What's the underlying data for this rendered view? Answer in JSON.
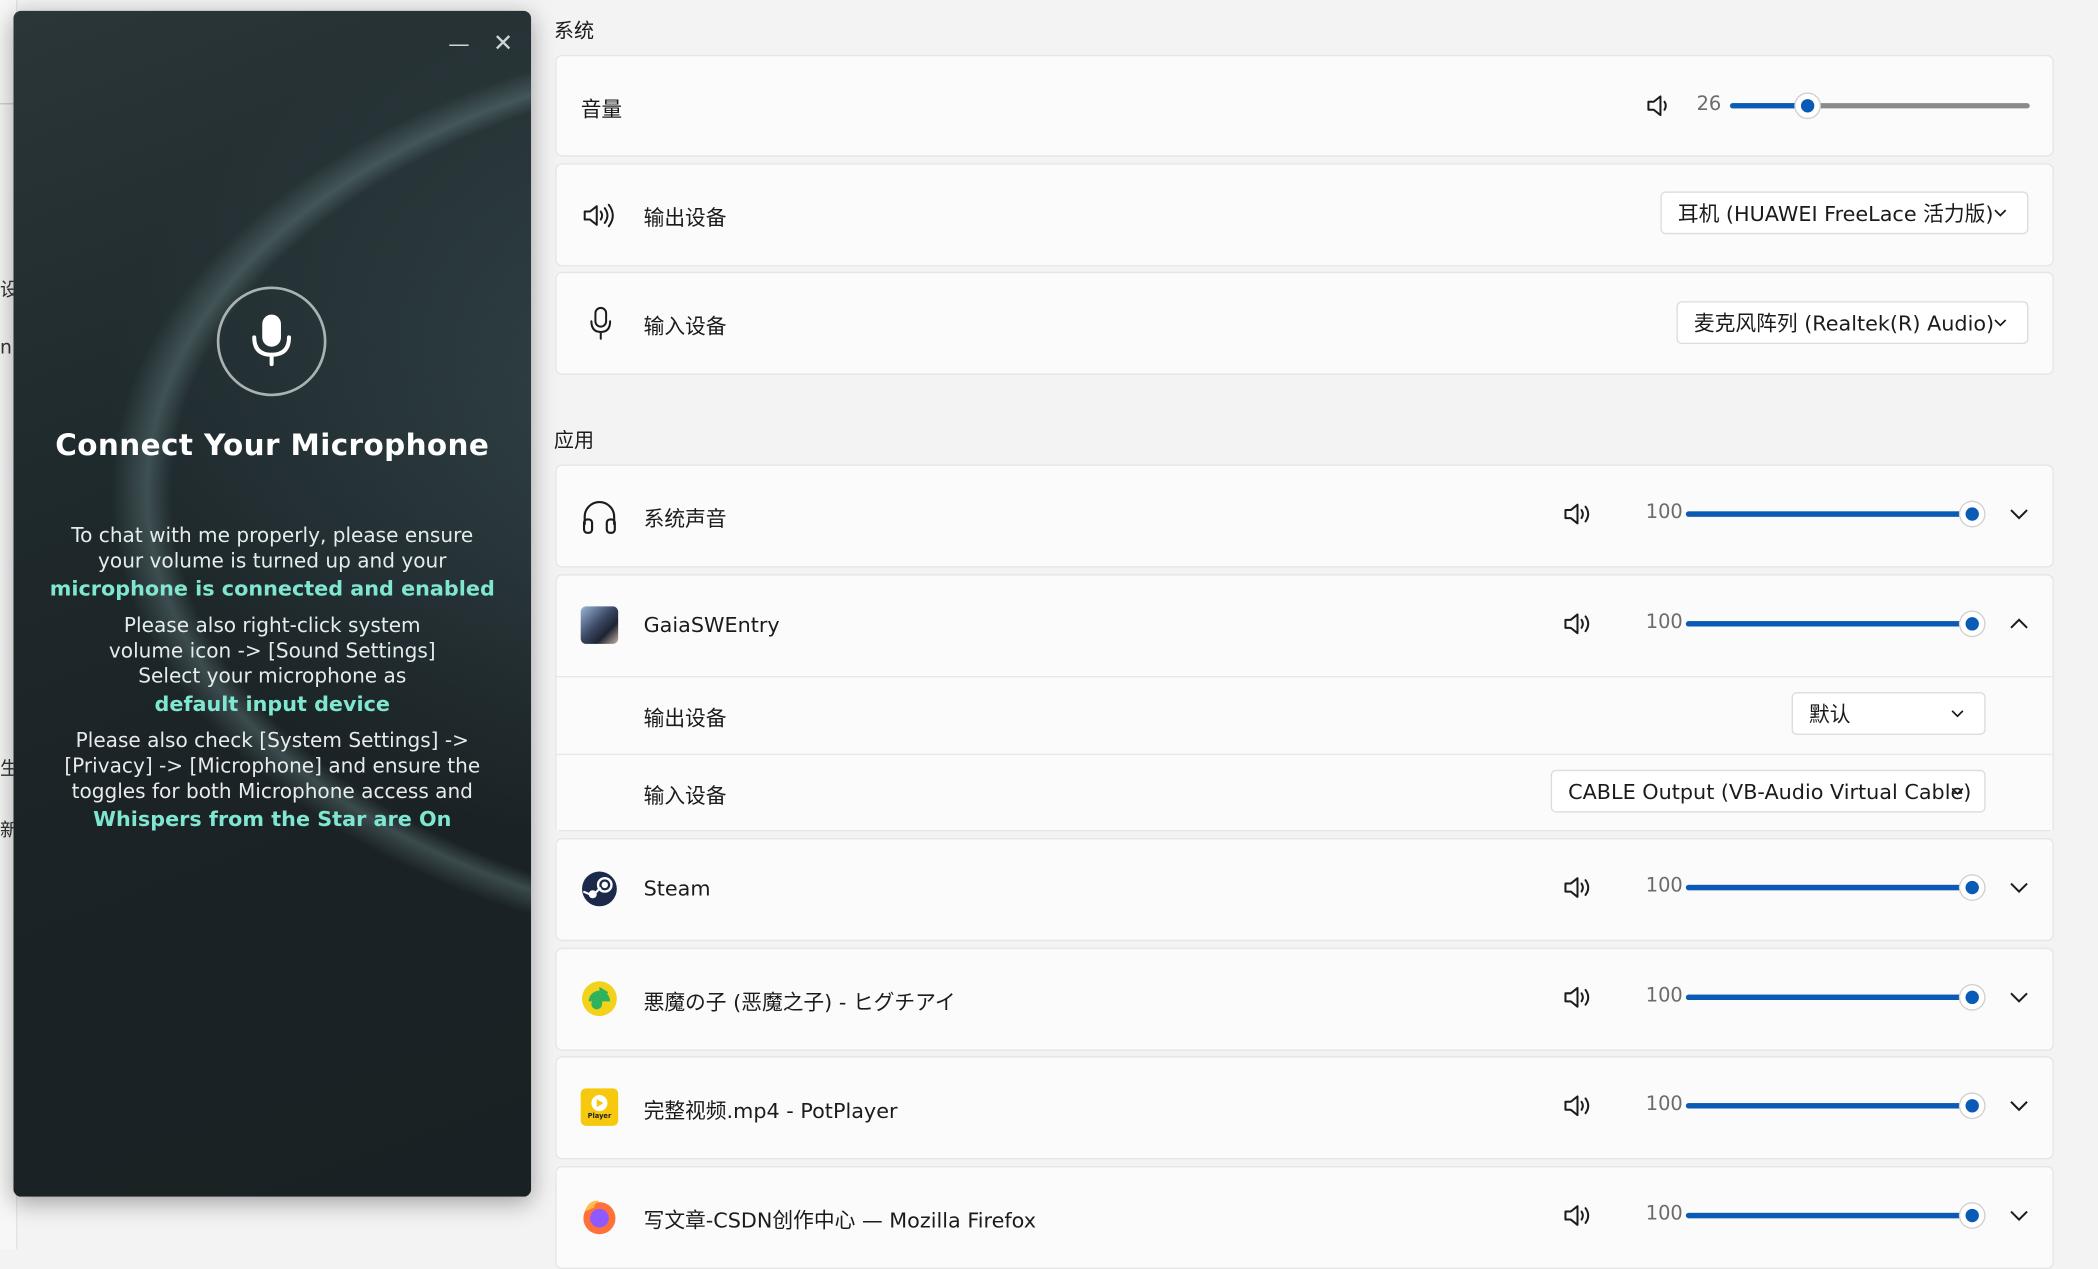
{
  "edge": {
    "chars": [
      "设",
      "n",
      "生",
      "新"
    ]
  },
  "dialog": {
    "minimize_label": "—",
    "close_label": "✕",
    "title": "Connect Your Microphone",
    "p1": [
      "To chat with me properly, please ensure",
      "your volume is turned up and your"
    ],
    "h1": "microphone is connected and enabled",
    "p2": [
      "Please also right-click system",
      "volume icon -> [Sound Settings]",
      "Select your microphone as"
    ],
    "h2": "default input device",
    "p3": [
      "Please also check [System Settings] ->",
      "[Privacy] -> [Microphone] and ensure the",
      "toggles for both Microphone access and"
    ],
    "h3": "Whispers from the Star are On"
  },
  "system": {
    "title": "系统",
    "volume": {
      "label": "音量",
      "value": "26",
      "level": 0.26
    },
    "output": {
      "label": "输出设备",
      "selected": "耳机 (HUAWEI FreeLace 活力版)"
    },
    "input": {
      "label": "输入设备",
      "selected": "麦克风阵列 (Realtek(R) Audio)"
    }
  },
  "apps": {
    "title": "应用",
    "items": [
      {
        "name": "系统声音",
        "value": "100",
        "icon": "headphones-icon"
      },
      {
        "name": "GaiaSWEntry",
        "value": "100",
        "icon": "app-avatar-icon",
        "expanded": {
          "output_label": "输出设备",
          "output_selected": "默认",
          "input_label": "输入设备",
          "input_selected": "CABLE Output (VB-Audio Virtual Cable)"
        }
      },
      {
        "name": "Steam",
        "value": "100",
        "icon": "steam-icon"
      },
      {
        "name": "悪魔の子 (恶魔之子) - ヒグチアイ",
        "value": "100",
        "icon": "qq-music-icon"
      },
      {
        "name": "完整视频.mp4 - PotPlayer",
        "value": "100",
        "icon": "potplayer-icon",
        "icon_text": "Player"
      },
      {
        "name": "写文章-CSDN创作中心 — Mozilla Firefox",
        "value": "100",
        "icon": "firefox-icon"
      }
    ]
  },
  "colors": {
    "accent": "#0a5bb5",
    "highlight": "#7fe6cf"
  }
}
